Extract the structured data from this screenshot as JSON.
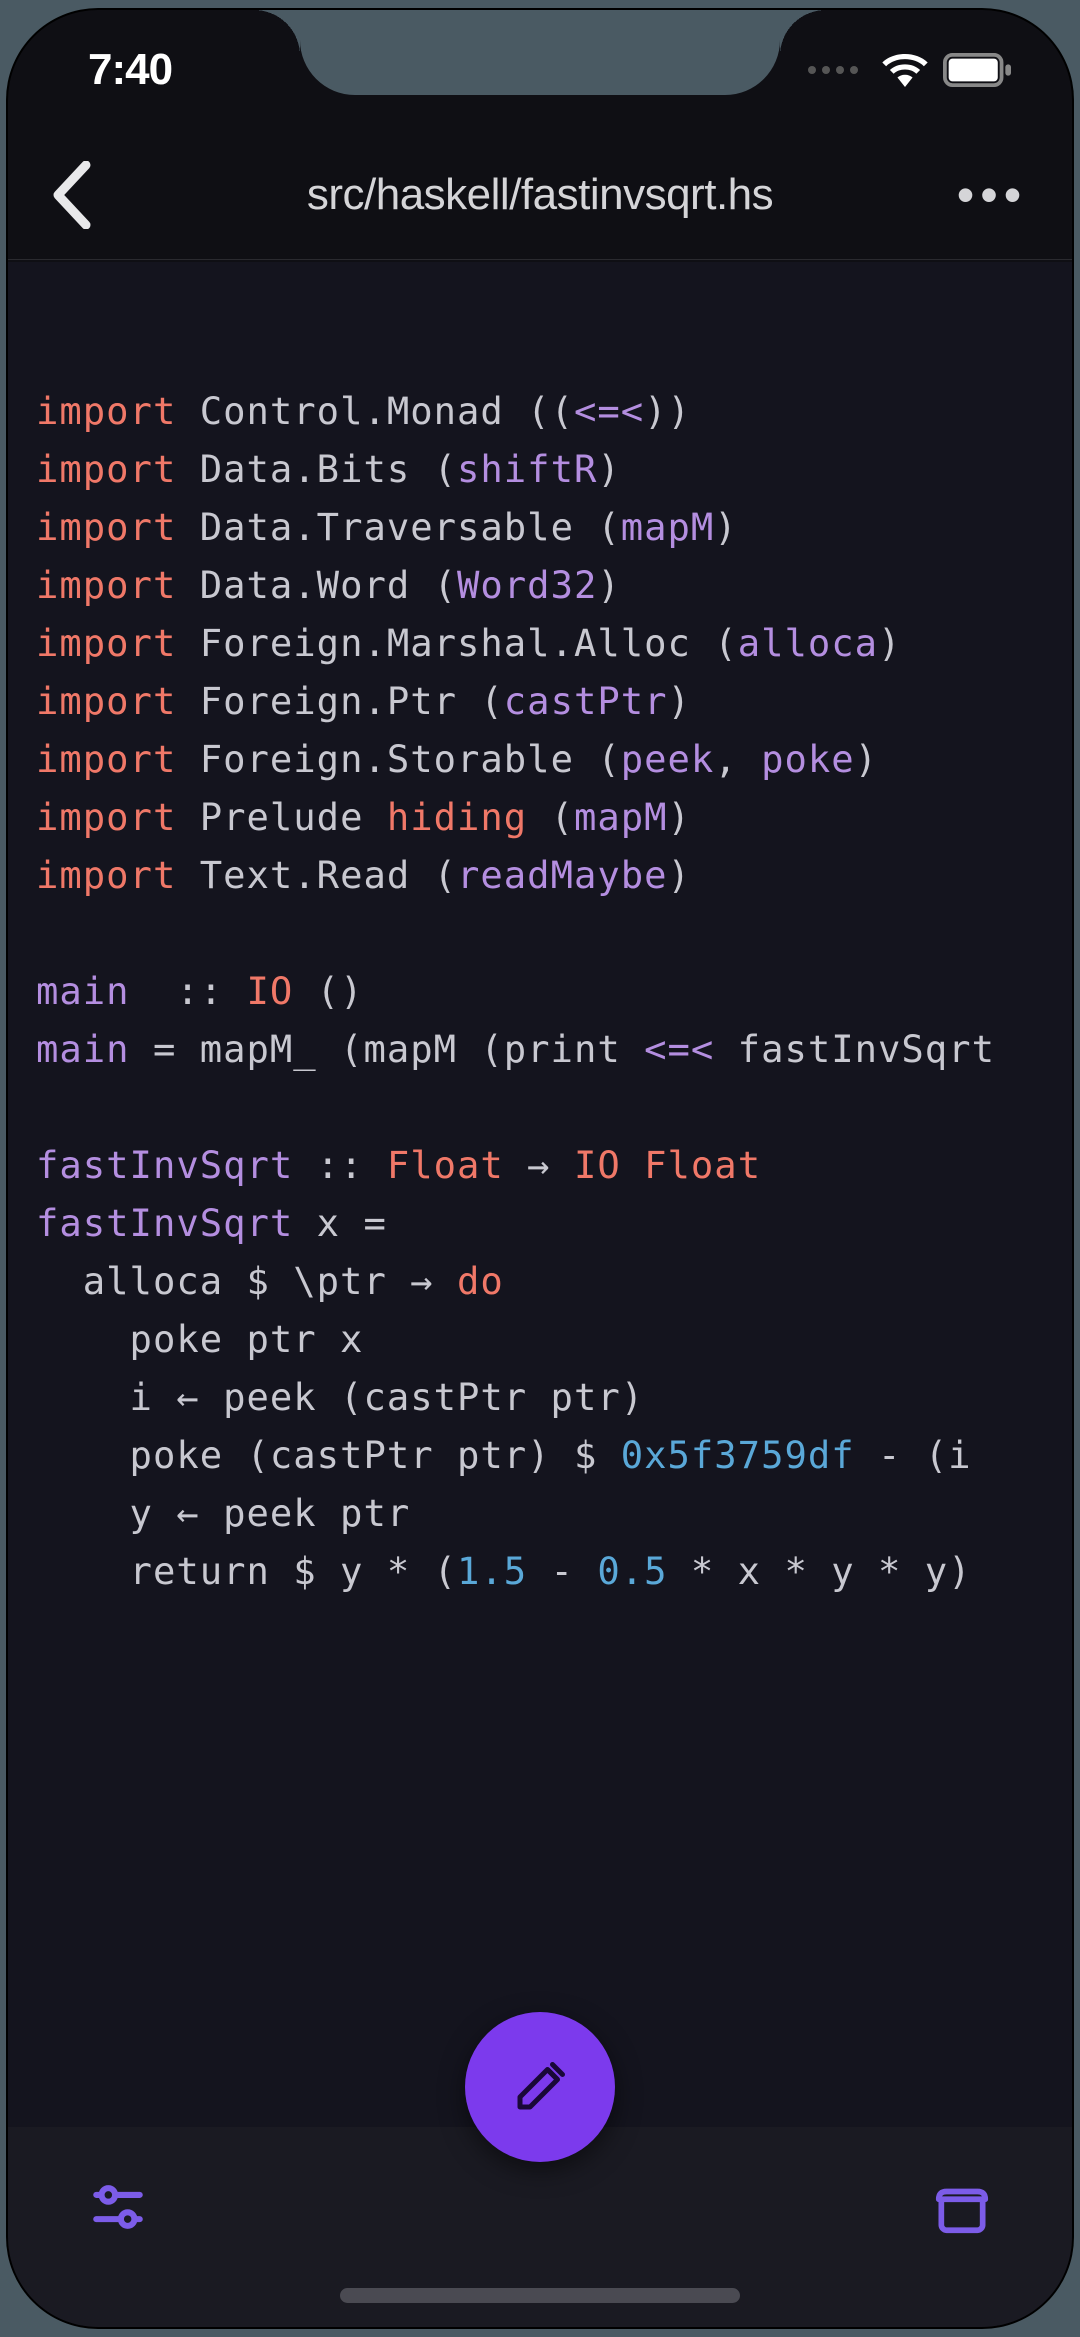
{
  "status": {
    "time": "7:40"
  },
  "nav": {
    "title": "src/haskell/fastinvsqrt.hs"
  },
  "code": {
    "l1_kw": "import",
    "l1_mod": " Control.Monad ((",
    "l1_fn": "<=<",
    "l1_end": "))",
    "l2_kw": "import",
    "l2_mod": " Data.Bits (",
    "l2_fn": "shiftR",
    "l2_end": ")",
    "l3_kw": "import",
    "l3_mod": " Data.Traversable (",
    "l3_fn": "mapM",
    "l3_end": ")",
    "l4_kw": "import",
    "l4_mod": " Data.Word (",
    "l4_fn": "Word32",
    "l4_end": ")",
    "l5_kw": "import",
    "l5_mod": " Foreign.Marshal.Alloc (",
    "l5_fn": "alloca",
    "l5_end": ")",
    "l6_kw": "import",
    "l6_mod": " Foreign.Ptr (",
    "l6_fn": "castPtr",
    "l6_end": ")",
    "l7_kw": "import",
    "l7_mod": " Foreign.Storable (",
    "l7_fn1": "peek",
    "l7_sep": ", ",
    "l7_fn2": "poke",
    "l7_end": ")",
    "l8_kw": "import",
    "l8_mod": " Prelude ",
    "l8_hiding": "hiding",
    "l8_rest": " (",
    "l8_fn": "mapM",
    "l8_end": ")",
    "l9_kw": "import",
    "l9_mod": " Text.Read (",
    "l9_fn": "readMaybe",
    "l9_end": ")",
    "l11_main": "main",
    "l11_dcolon": "  :: ",
    "l11_io": "IO",
    "l11_unit": " ()",
    "l12_main": "main",
    "l12_eq": " = mapM_ (mapM (print ",
    "l12_op": "<=<",
    "l12_rest": " fastInvSqrt",
    "l14_fis": "fastInvSqrt",
    "l14_dcolon": " :: ",
    "l14_float1": "Float",
    "l14_arr": " → ",
    "l14_io": "IO Float",
    "l15_fis": "fastInvSqrt",
    "l15_rest": " x =",
    "l16": "  alloca $ \\ptr → ",
    "l16_do": "do",
    "l17": "    poke ptr x",
    "l18": "    i ← peek (castPtr ptr)",
    "l19a": "    poke (castPtr ptr) $ ",
    "l19_hex": "0x5f3759df",
    "l19b": " - (i ",
    "l20": "    y ← peek ptr",
    "l21a": "    return $ y * (",
    "l21_n1": "1.5",
    "l21b": " - ",
    "l21_n2": "0.5",
    "l21c": " * x * y * y)"
  }
}
